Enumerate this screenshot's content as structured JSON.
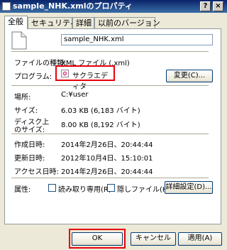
{
  "window": {
    "title": "sample_NHK.xmlのプロパティ",
    "help_glyph": "?",
    "close_glyph": "×"
  },
  "tabs": [
    {
      "label": "全般",
      "active": true
    },
    {
      "label": "セキュリティ",
      "active": false
    },
    {
      "label": "詳細",
      "active": false
    },
    {
      "label": "以前のバージョン",
      "active": false
    }
  ],
  "general": {
    "file_name": "sample_NHK.xml",
    "type_label": "ファイルの種類:",
    "type_value": "XML ファイル (.xml)",
    "program_label": "プログラム:",
    "program_value": "サクラエディタ",
    "change_button": "変更(C)...",
    "location_label": "場所:",
    "location_value": "C:¥user",
    "size_label": "サイズ:",
    "size_value": "6.03 KB (6,183 バイト)",
    "disk_label_1": "ディスク上",
    "disk_label_2": "のサイズ:",
    "disk_value": "8.00 KB (8,192 バイト)",
    "created_label": "作成日時:",
    "created_value": "2014年2月26日、20:44:44",
    "modified_label": "更新日時:",
    "modified_value": "2012年10月4日、15:10:01",
    "accessed_label": "アクセス日時:",
    "accessed_value": "2014年2月26日、20:44:44",
    "attr_label": "属性:",
    "readonly_label": "読み取り専用(R)",
    "hidden_label": "隠しファイル(H)",
    "advanced_button": "詳細設定(D)..."
  },
  "buttons": {
    "ok": "OK",
    "cancel": "キャンセル",
    "apply": "適用(A)"
  },
  "highlight_color": "#e8000b"
}
